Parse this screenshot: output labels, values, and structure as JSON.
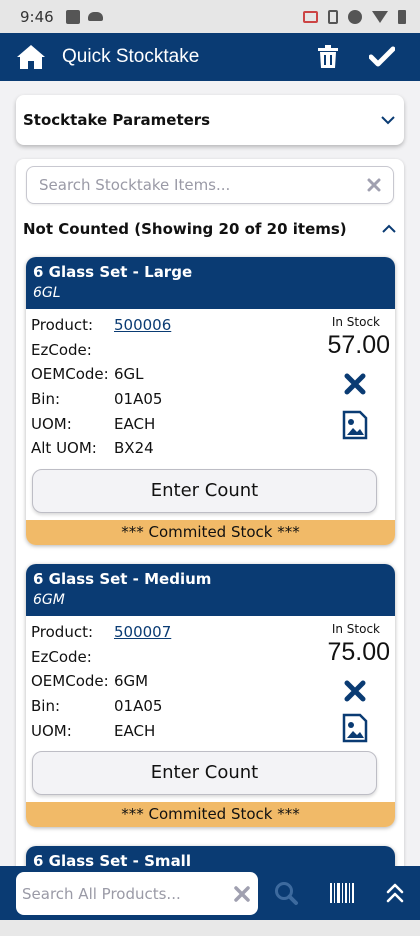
{
  "status_bar": {
    "time": "9:46"
  },
  "app_bar": {
    "title": "Quick Stocktake"
  },
  "parameters": {
    "title": "Stocktake Parameters"
  },
  "item_search": {
    "placeholder": "Search Stocktake Items..."
  },
  "not_counted": {
    "title": "Not Counted (Showing 20 of 20 items)"
  },
  "labels": {
    "product": "Product:",
    "ezcode": "EzCode:",
    "oemcode": "OEMCode:",
    "bin": "Bin:",
    "uom": "UOM:",
    "alt_uom": "Alt UOM:",
    "in_stock": "In Stock",
    "enter_count": "Enter Count",
    "committed": "*** Commited Stock ***"
  },
  "items": [
    {
      "name": "6 Glass Set - Large",
      "code": "6GL",
      "product": "500006",
      "ezcode": "",
      "oemcode": "6GL",
      "bin": "01A05",
      "uom": "EACH",
      "alt_uom": "BX24",
      "in_stock": "57.00"
    },
    {
      "name": "6 Glass Set - Medium",
      "code": "6GM",
      "product": "500007",
      "ezcode": "",
      "oemcode": "6GM",
      "bin": "01A05",
      "uom": "EACH",
      "in_stock": "75.00"
    },
    {
      "name": "6 Glass Set - Small"
    }
  ],
  "bottom_search": {
    "placeholder": "Search All Products..."
  },
  "colors": {
    "primary": "#0a3b73",
    "committed": "#f1ba68",
    "background": "#f2f2f4"
  }
}
